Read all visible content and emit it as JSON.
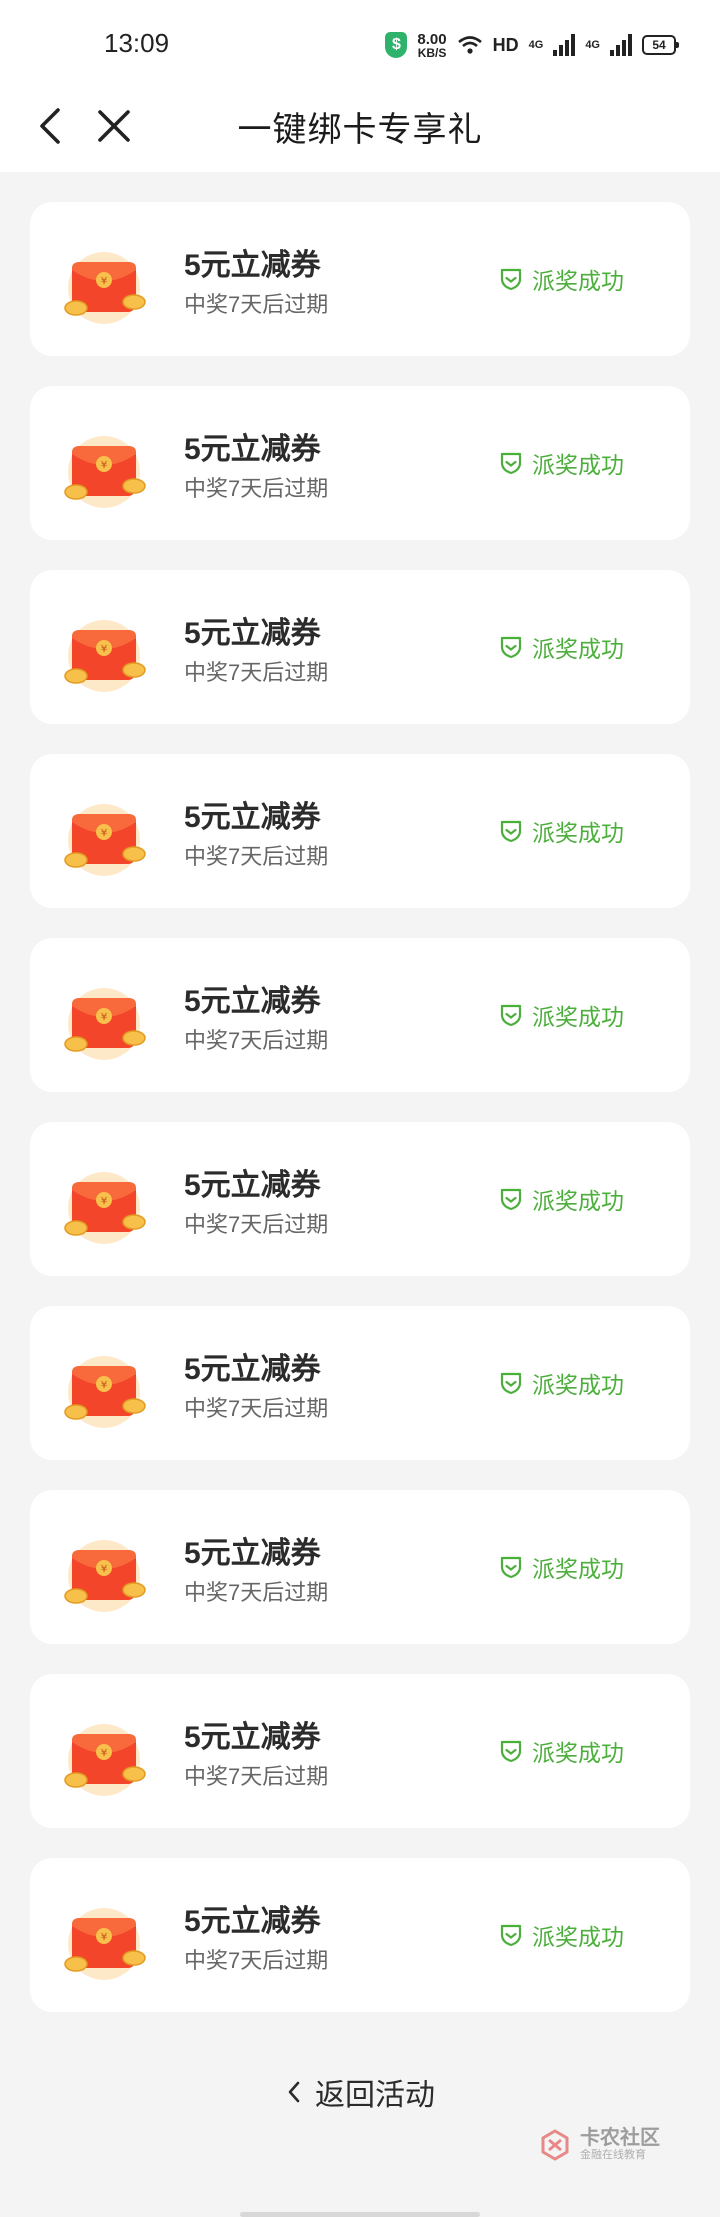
{
  "status_bar": {
    "time": "13:09",
    "net_speed_value": "8.00",
    "net_speed_unit": "KB/S",
    "hd_label": "HD",
    "sig1_label": "4G",
    "sig2_label": "4G",
    "battery": "54"
  },
  "header": {
    "title": "一键绑卡专享礼"
  },
  "rewards": [
    {
      "title": "5元立减券",
      "subtitle": "中奖7天后过期",
      "status": "派奖成功"
    },
    {
      "title": "5元立减券",
      "subtitle": "中奖7天后过期",
      "status": "派奖成功"
    },
    {
      "title": "5元立减券",
      "subtitle": "中奖7天后过期",
      "status": "派奖成功"
    },
    {
      "title": "5元立减券",
      "subtitle": "中奖7天后过期",
      "status": "派奖成功"
    },
    {
      "title": "5元立减券",
      "subtitle": "中奖7天后过期",
      "status": "派奖成功"
    },
    {
      "title": "5元立减券",
      "subtitle": "中奖7天后过期",
      "status": "派奖成功"
    },
    {
      "title": "5元立减券",
      "subtitle": "中奖7天后过期",
      "status": "派奖成功"
    },
    {
      "title": "5元立减券",
      "subtitle": "中奖7天后过期",
      "status": "派奖成功"
    },
    {
      "title": "5元立减券",
      "subtitle": "中奖7天后过期",
      "status": "派奖成功"
    },
    {
      "title": "5元立减券",
      "subtitle": "中奖7天后过期",
      "status": "派奖成功"
    }
  ],
  "footer": {
    "back_label": "返回活动"
  },
  "watermark": {
    "title": "卡农社区",
    "subtitle": "金融在线教育"
  },
  "colors": {
    "success": "#4caf3c",
    "envelope": "#f2452a",
    "accent_gold": "#f7c04a"
  }
}
